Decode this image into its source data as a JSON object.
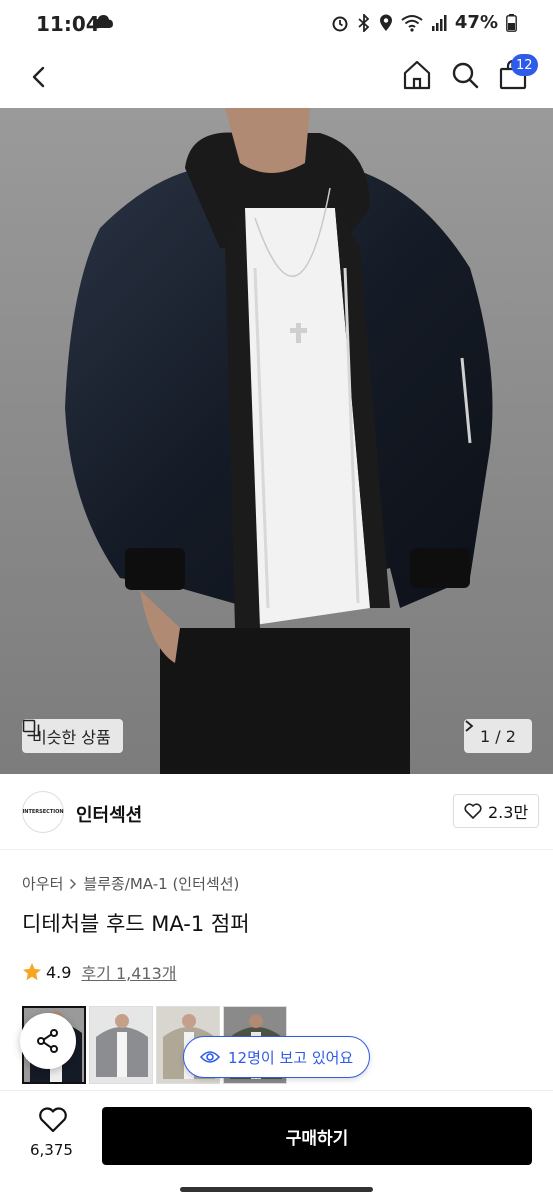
{
  "status": {
    "time": "11:04",
    "battery": "47%"
  },
  "nav": {
    "icons": [
      "back-icon",
      "home-icon",
      "search-icon",
      "bag-icon"
    ],
    "cart_badge": "12"
  },
  "hero": {
    "similar_label": "비슷한 상품",
    "pager": "1 / 2"
  },
  "brand": {
    "logo_text": "INTERSECTION",
    "name": "인터섹션",
    "likes": "2.3만"
  },
  "product": {
    "breadcrumb": [
      "아우터",
      "블루종/MA-1 (인터섹션)"
    ],
    "title": "디테처블 후드 MA-1 점퍼",
    "rating": "4.9",
    "reviews": "후기 1,413개"
  },
  "viewers": "12명이 보고 있어요",
  "bottom": {
    "wish_count": "6,375",
    "buy_label": "구매하기"
  },
  "colors": {
    "accent": "#2F5BEA",
    "star": "#F5A623",
    "buy_button": "#000000"
  }
}
